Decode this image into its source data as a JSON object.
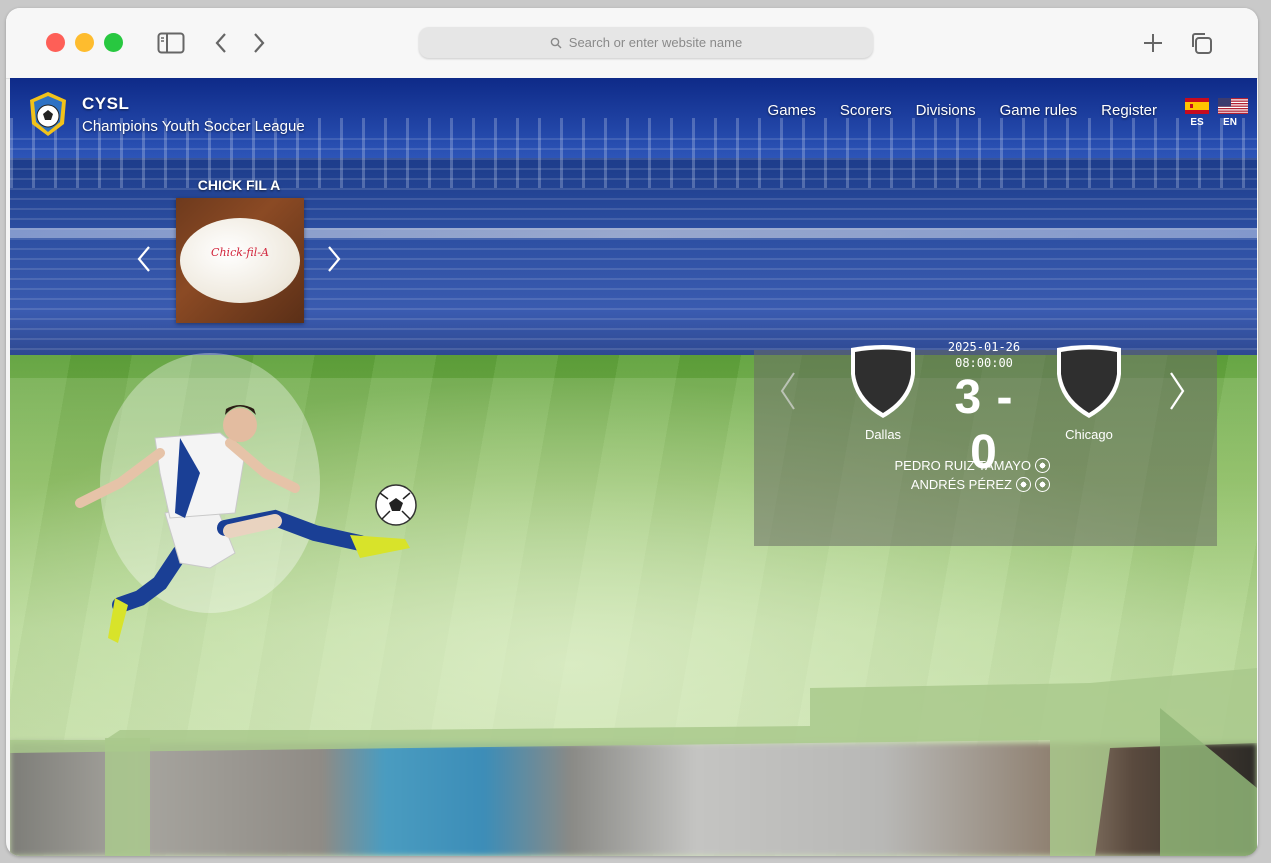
{
  "browser": {
    "url_placeholder": "Search or enter website name"
  },
  "site": {
    "short_name": "CYSL",
    "full_name": "Champions Youth Soccer League"
  },
  "nav": {
    "links": [
      "Games",
      "Scorers",
      "Divisions",
      "Game rules",
      "Register"
    ],
    "languages": [
      {
        "code": "ES",
        "flag": "spain-flag-icon"
      },
      {
        "code": "EN",
        "flag": "us-flag-icon"
      }
    ]
  },
  "sponsor": {
    "title": "CHICK FIL A",
    "logo_text": "Chick-fil-A"
  },
  "game": {
    "date": "2025-01-26",
    "time": "08:00:00",
    "home_team": "Dallas",
    "away_team": "Chicago",
    "score": "3 - 0",
    "scorers": [
      {
        "name": "PEDRO RUIZ TAMAYO",
        "goals": 1
      },
      {
        "name": "ANDRÉS PÉREZ",
        "goals": 2
      }
    ]
  },
  "colors": {
    "accent": "#2c4fa3",
    "field": "#8cbd5e",
    "panel": "#6e7366"
  }
}
